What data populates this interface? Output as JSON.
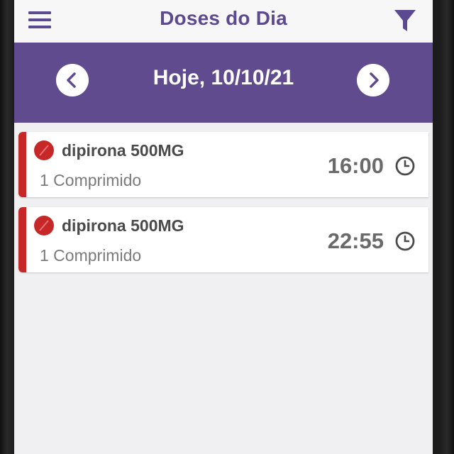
{
  "header": {
    "title": "Doses do Dia",
    "menu_icon": "hamburger-menu-icon",
    "filter_icon": "funnel-filter-icon"
  },
  "date_nav": {
    "label": "Hoje, 10/10/21",
    "prev_icon": "chevron-left-icon",
    "next_icon": "chevron-right-icon"
  },
  "doses": [
    {
      "name": "dipirona 500MG",
      "quantity": "1 Comprimido",
      "time": "16:00",
      "pill_icon": "pill-icon",
      "time_icon": "clock-icon"
    },
    {
      "name": "dipirona 500MG",
      "quantity": "1 Comprimido",
      "time": "22:55",
      "pill_icon": "pill-icon",
      "time_icon": "clock-icon"
    }
  ],
  "colors": {
    "primary": "#5f4b8e",
    "title": "#5c4a90",
    "dose_accent": "#c62828",
    "background": "#f0f0f2"
  }
}
